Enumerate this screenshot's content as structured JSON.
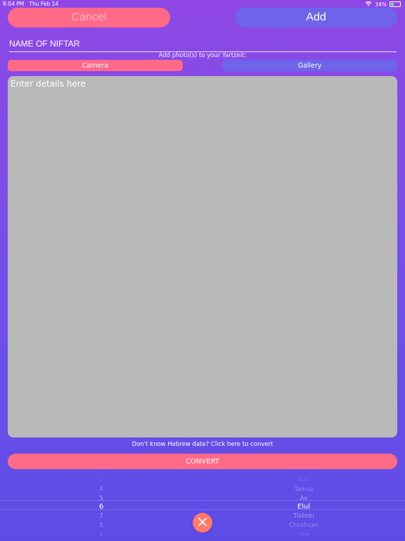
{
  "status_bar": {
    "time": "8:04 PM",
    "date": "Thu Feb 14",
    "battery": "34%",
    "battery_level": 0.34
  },
  "header": {
    "cancel_label": "Cancel",
    "add_label": "Add"
  },
  "form": {
    "name_placeholder": "NAME OF NIFTAR",
    "photo_caption": "Add photo(s) to your Yartzeit:",
    "camera_label": "Camera",
    "gallery_label": "Gallery",
    "details_placeholder": "Enter details here",
    "convert_hint": "Don't know Hebrew date? Click here to convert",
    "convert_label": "CONVERT"
  },
  "picker": {
    "days": [
      "3",
      "4",
      "5",
      "6",
      "7",
      "8",
      "9"
    ],
    "months": [
      "Sivan",
      "Tamuz",
      "Av",
      "Elul",
      "Tishrei",
      "Cheshvan",
      "Kislev"
    ],
    "selected_index": 3
  },
  "colors": {
    "accent_pink": "#ff6a87",
    "accent_blue": "#6e64ea",
    "close_orange": "#ff7a6e"
  }
}
